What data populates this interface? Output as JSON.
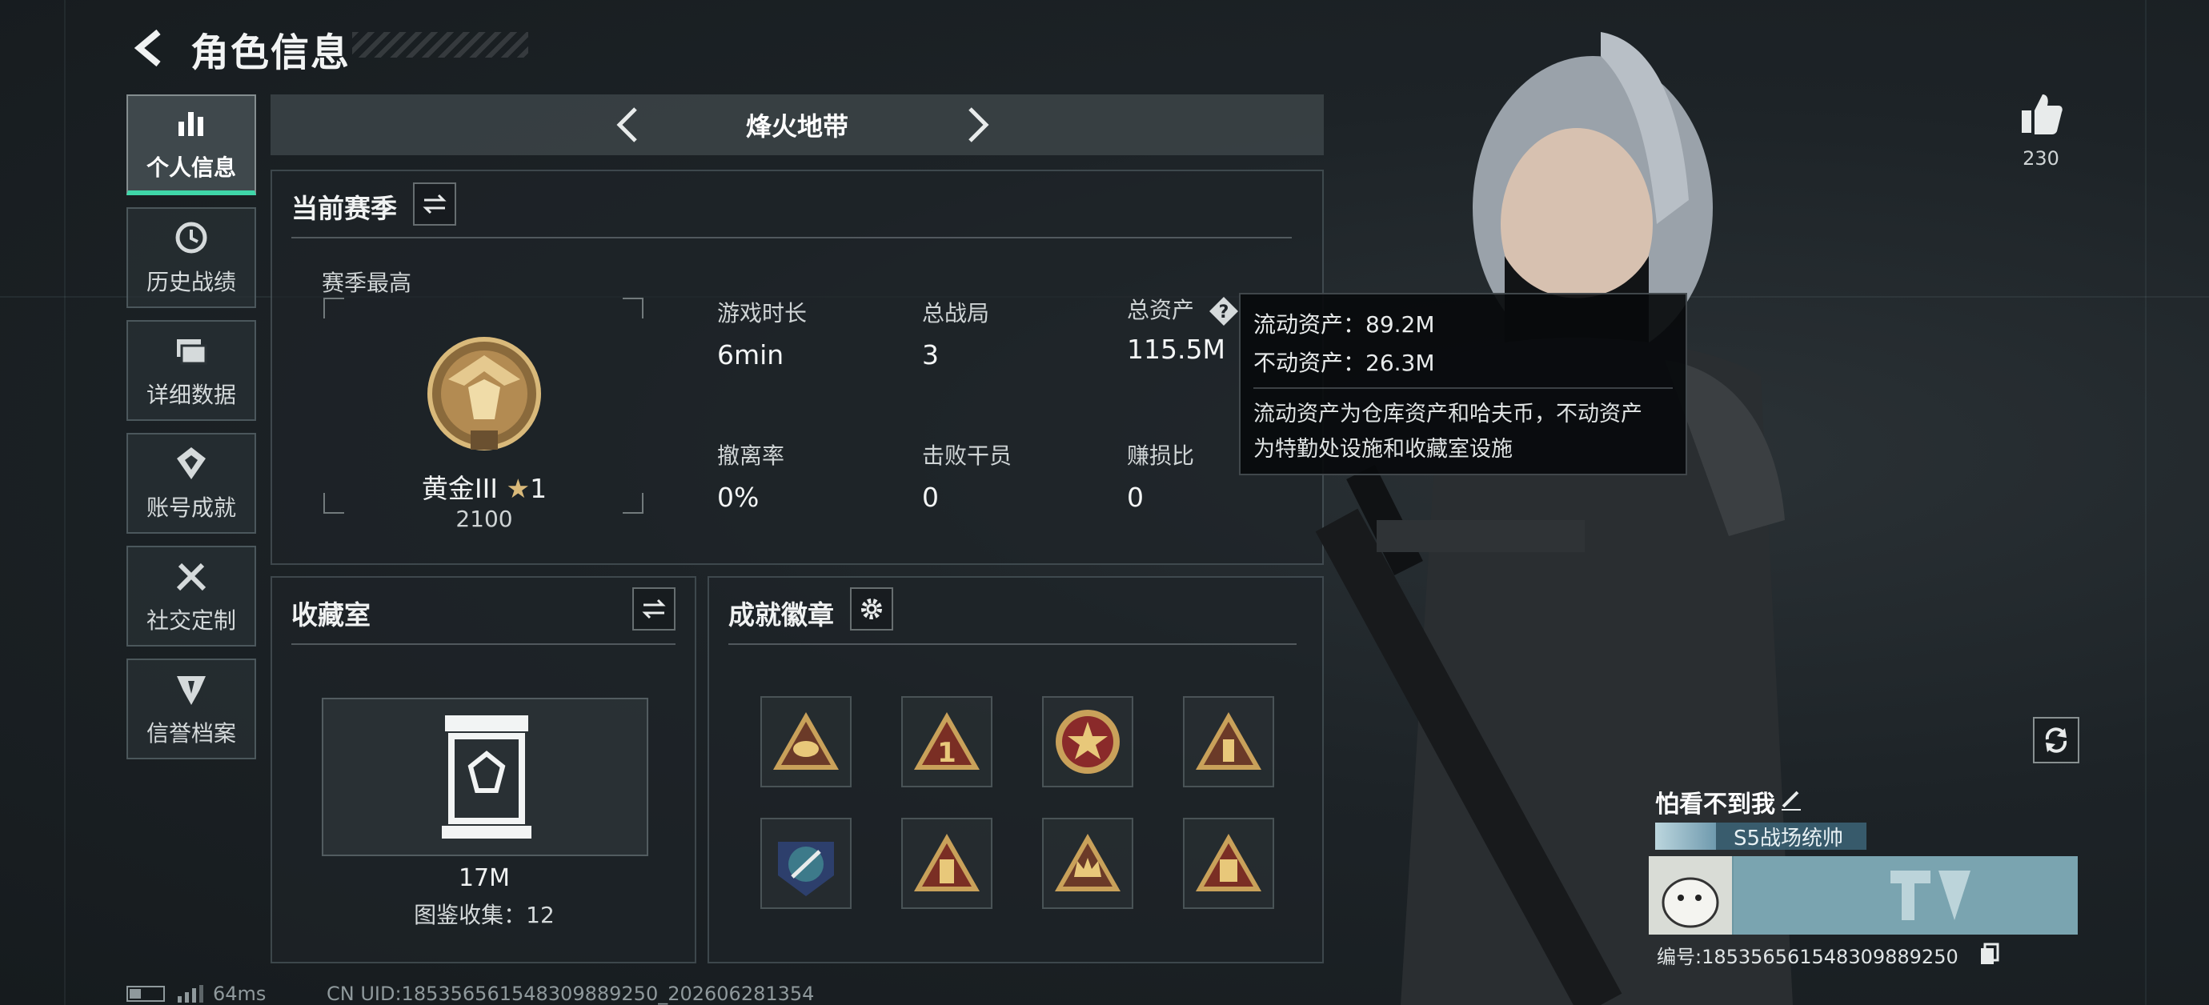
{
  "header": {
    "title": "角色信息"
  },
  "sidebar": {
    "items": [
      {
        "label": "个人信息",
        "icon": "bar-chart-icon",
        "active": true
      },
      {
        "label": "历史战绩",
        "icon": "clock-icon"
      },
      {
        "label": "详细数据",
        "icon": "folder-icon"
      },
      {
        "label": "账号成就",
        "icon": "medal-icon"
      },
      {
        "label": "社交定制",
        "icon": "tools-icon"
      },
      {
        "label": "信誉档案",
        "icon": "emblem-icon"
      }
    ]
  },
  "mode": {
    "title": "烽火地带"
  },
  "season": {
    "header": "当前赛季",
    "best_label": "赛季最高",
    "rank_name": "黄金III",
    "rank_stars": "1",
    "rank_score": "2100",
    "stats": {
      "play_time": {
        "label": "游戏时长",
        "value": "6min"
      },
      "total_matches": {
        "label": "总战局",
        "value": "3"
      },
      "total_assets": {
        "label": "总资产",
        "value": "115.5M"
      },
      "extract_rate": {
        "label": "撤离率",
        "value": "0%"
      },
      "kills": {
        "label": "击败干员",
        "value": "0"
      },
      "profit_ratio": {
        "label": "赚损比",
        "value": "0"
      }
    }
  },
  "tooltip": {
    "liquid": "流动资产：89.2M",
    "fixed": "不动资产：26.3M",
    "desc_line1": "流动资产为仓库资产和哈夫币，不动资产",
    "desc_line2": "为特勤处设施和收藏室设施"
  },
  "collection": {
    "header": "收藏室",
    "value": "17M",
    "count": "图鉴收集：12"
  },
  "achievements": {
    "header": "成就徽章",
    "badges": [
      "triangle-helmet-badge",
      "triangle-one-badge",
      "star-shield-badge",
      "triangle-soldier-badge",
      "wings-crest-badge",
      "triangle-tower-badge",
      "triangle-crown-badge",
      "triangle-sb-badge"
    ]
  },
  "profile": {
    "likes": "230",
    "name": "怕看不到我",
    "title_tag": "S5战场统帅",
    "uid_line": "编号:185356561548309889250"
  },
  "footer": {
    "ping": "64ms",
    "uid": "CN UID:185356561548309889250_202606281354"
  },
  "colors": {
    "accent": "#3fd6a8",
    "panel_bg": "#1e2428",
    "gold": "#c9a15a"
  }
}
